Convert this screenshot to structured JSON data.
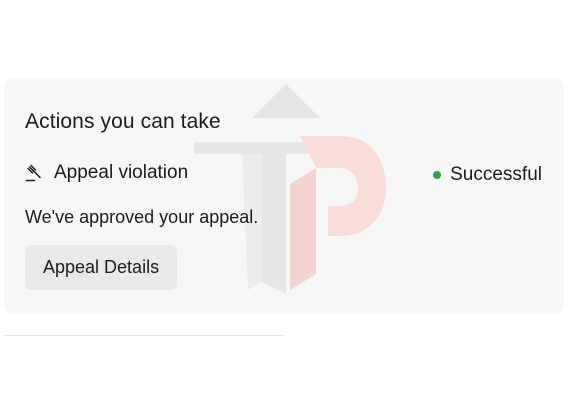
{
  "actions_card": {
    "title": "Actions you can take",
    "action": {
      "icon": "gavel-icon",
      "label": "Appeal violation"
    },
    "status": {
      "label": "Successful",
      "color": "#31a24c"
    },
    "message": "We've approved your appeal.",
    "details_button_label": "Appeal Details"
  },
  "watermark": {
    "description_icon": "tp-logo-watermark",
    "colors": [
      "#e3e3e3",
      "#f6d9d6"
    ]
  }
}
